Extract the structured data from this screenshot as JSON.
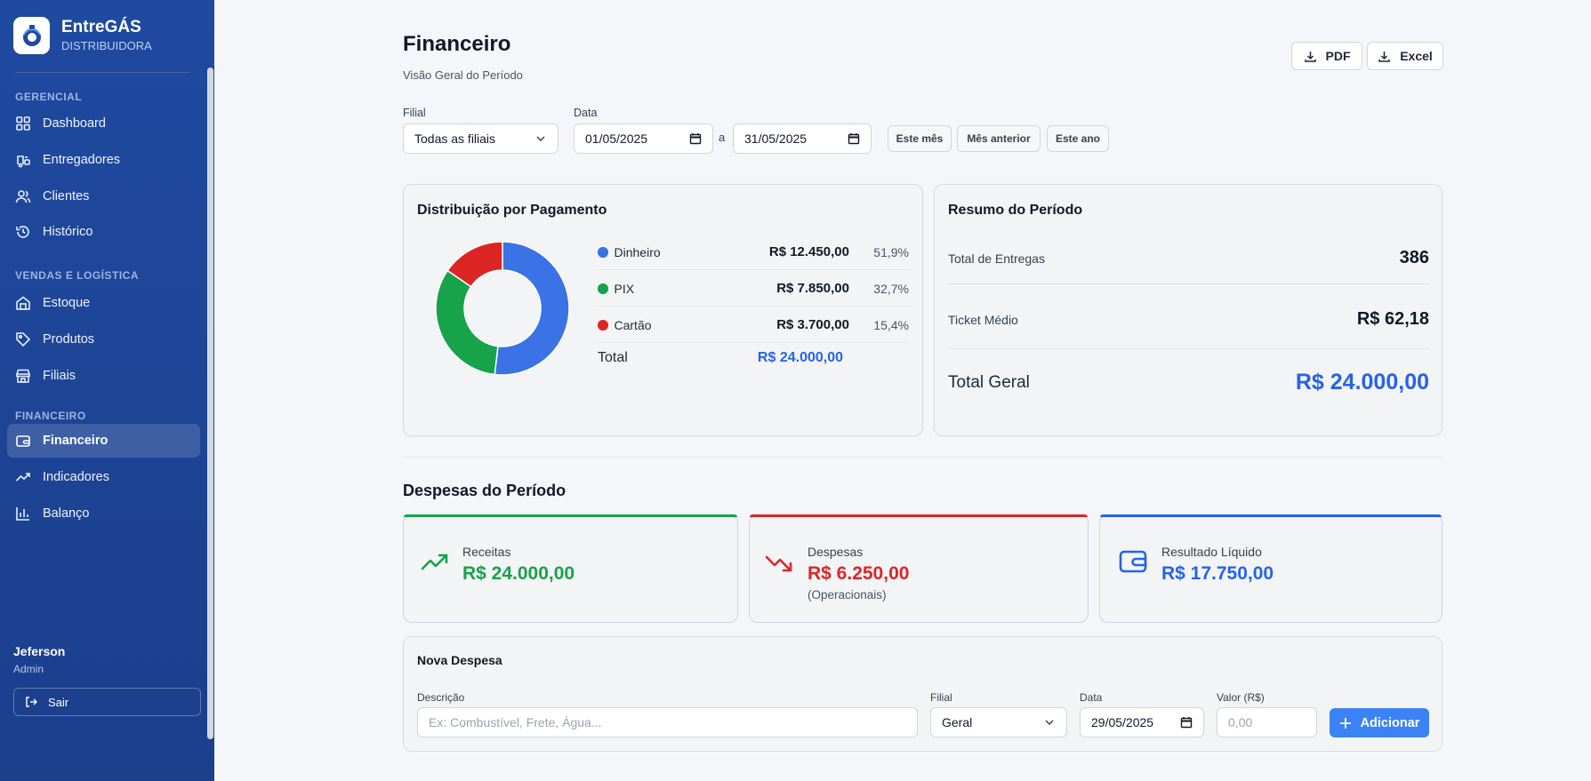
{
  "brand": {
    "name": "EntreGÁS",
    "subtitle": "DISTRIBUIDORA"
  },
  "sidebar": {
    "sections": [
      {
        "title": "GERENCIAL",
        "items": [
          {
            "label": "Dashboard",
            "icon": "grid-icon"
          },
          {
            "label": "Entregadores",
            "icon": "courier-icon"
          },
          {
            "label": "Clientes",
            "icon": "users-icon"
          },
          {
            "label": "Histórico",
            "icon": "history-icon"
          }
        ]
      },
      {
        "title": "VENDAS E LOGÍSTICA",
        "items": [
          {
            "label": "Estoque",
            "icon": "warehouse-icon"
          },
          {
            "label": "Produtos",
            "icon": "tag-icon"
          },
          {
            "label": "Filiais",
            "icon": "store-icon"
          }
        ]
      },
      {
        "title": "FINANCEIRO",
        "items": [
          {
            "label": "Financeiro",
            "icon": "wallet-icon",
            "active": true
          },
          {
            "label": "Indicadores",
            "icon": "trend-icon"
          },
          {
            "label": "Balanço",
            "icon": "bar-chart-icon"
          }
        ]
      }
    ],
    "user": {
      "name": "Jeferson",
      "role": "Admin"
    },
    "logout_label": "Sair"
  },
  "header": {
    "title": "Financeiro",
    "subtitle": "Visão Geral do Período",
    "export_pdf": "PDF",
    "export_excel": "Excel"
  },
  "filters": {
    "branch_label": "Filial",
    "branch_value": "Todas as filiais",
    "date_label": "Data",
    "date_from": "01/05/2025",
    "date_sep": "a",
    "date_to": "31/05/2025",
    "quick": [
      "Este mês",
      "Mês anterior",
      "Este ano"
    ]
  },
  "payment_card": {
    "title": "Distribuição por Pagamento",
    "rows": [
      {
        "name": "Dinheiro",
        "value": "R$ 12.450,00",
        "pct": "51,9%",
        "color": "#3b73e6"
      },
      {
        "name": "PIX",
        "value": "R$ 7.850,00",
        "pct": "32,7%",
        "color": "#16a34a"
      },
      {
        "name": "Cartão",
        "value": "R$ 3.700,00",
        "pct": "15,4%",
        "color": "#dc2626"
      }
    ],
    "total_label": "Total",
    "total_value": "R$ 24.000,00"
  },
  "chart_data": {
    "type": "pie",
    "donut": true,
    "categories": [
      "Dinheiro",
      "PIX",
      "Cartão"
    ],
    "values": [
      12450,
      7850,
      3700
    ],
    "colors": [
      "#3b73e6",
      "#16a34a",
      "#dc2626"
    ]
  },
  "summary_card": {
    "title": "Resumo do Período",
    "deliveries_label": "Total de Entregas",
    "deliveries_value": "386",
    "ticket_label": "Ticket Médio",
    "ticket_value": "R$ 62,18",
    "total_label": "Total Geral",
    "total_value": "R$ 24.000,00"
  },
  "expenses": {
    "title": "Despesas do Período",
    "kpis": [
      {
        "label": "Receitas",
        "value": "R$ 24.000,00",
        "note": "",
        "color": "#16a34a",
        "icon": "trend-up-icon"
      },
      {
        "label": "Despesas",
        "value": "R$ 6.250,00",
        "note": "(Operacionais)",
        "color": "#dc2626",
        "icon": "trend-down-icon"
      },
      {
        "label": "Resultado Líquido",
        "value": "R$ 17.750,00",
        "note": "",
        "color": "#2563eb",
        "icon": "wallet-icon"
      }
    ]
  },
  "new_expense": {
    "title": "Nova Despesa",
    "desc_label": "Descrição",
    "desc_placeholder": "Ex: Combustível, Frete, Água...",
    "branch_label": "Filial",
    "branch_value": "Geral",
    "date_label": "Data",
    "date_value": "29/05/2025",
    "amount_label": "Valor (R$)",
    "amount_placeholder": "0,00",
    "add_label": "Adicionar"
  }
}
